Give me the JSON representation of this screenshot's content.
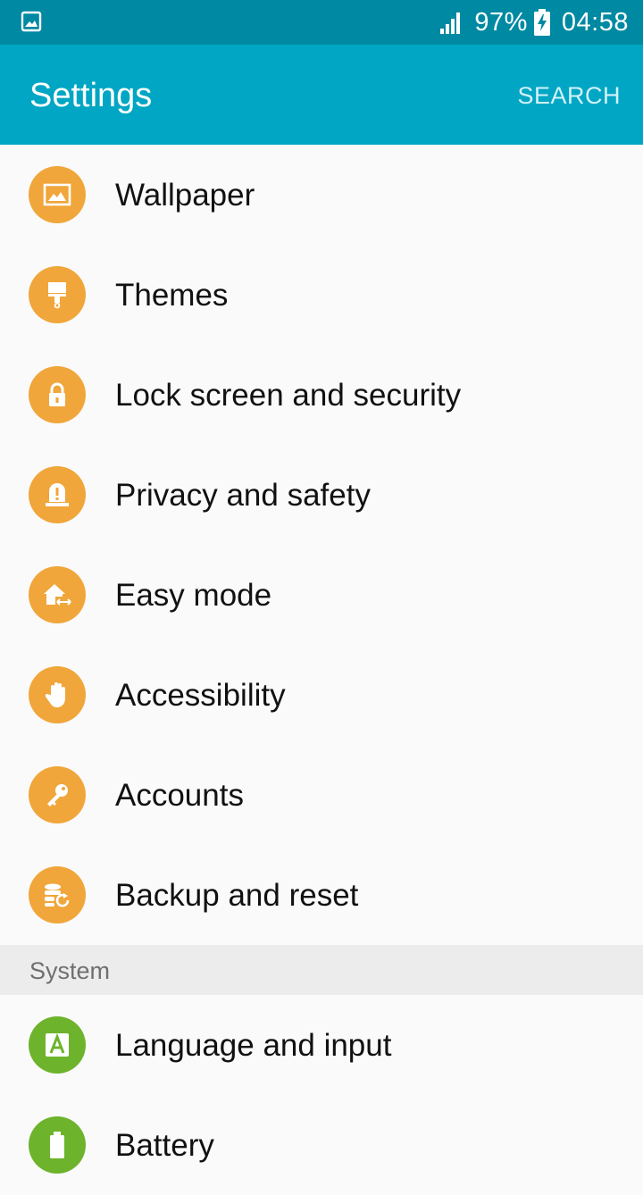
{
  "status_bar": {
    "battery_percent": "97%",
    "time": "04:58",
    "icons": [
      "gallery-notification-icon",
      "signal-icon",
      "battery-charging-icon"
    ]
  },
  "app_bar": {
    "title": "Settings",
    "search_label": "SEARCH",
    "color": "#00a6c4"
  },
  "items": [
    {
      "label": "Wallpaper",
      "icon": "wallpaper-icon",
      "color": "#f0a63a"
    },
    {
      "label": "Themes",
      "icon": "themes-brush-icon",
      "color": "#f0a63a"
    },
    {
      "label": "Lock screen and security",
      "icon": "lock-icon",
      "color": "#f0a63a"
    },
    {
      "label": "Privacy and safety",
      "icon": "privacy-alert-icon",
      "color": "#f0a63a"
    },
    {
      "label": "Easy mode",
      "icon": "easy-mode-home-icon",
      "color": "#f0a63a"
    },
    {
      "label": "Accessibility",
      "icon": "accessibility-hand-icon",
      "color": "#f0a63a"
    },
    {
      "label": "Accounts",
      "icon": "accounts-key-icon",
      "color": "#f0a63a"
    },
    {
      "label": "Backup and reset",
      "icon": "backup-reset-icon",
      "color": "#f0a63a"
    }
  ],
  "system_section": {
    "header": "System",
    "items": [
      {
        "label": "Language and input",
        "icon": "language-a-icon",
        "color": "#6db32c"
      },
      {
        "label": "Battery",
        "icon": "battery-icon",
        "color": "#6db32c"
      }
    ]
  }
}
